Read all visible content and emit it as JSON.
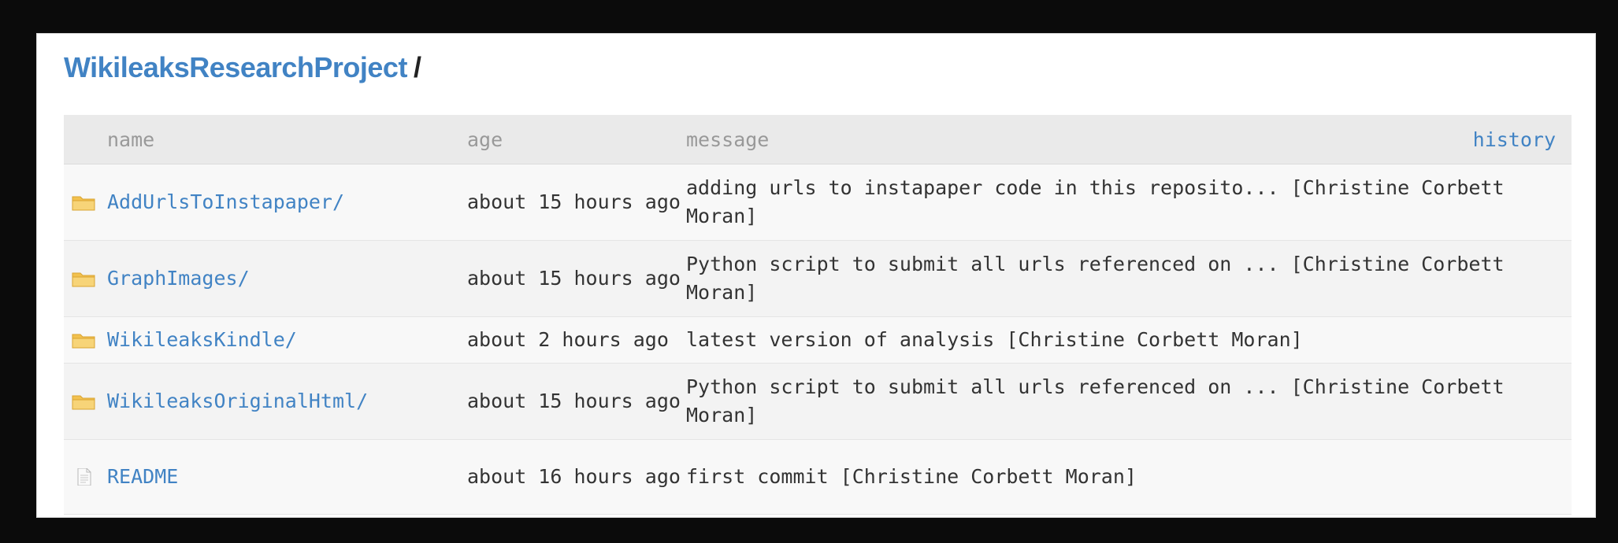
{
  "breadcrumb": {
    "repo": "WikileaksResearchProject",
    "separator": "/"
  },
  "table": {
    "headers": {
      "name": "name",
      "age": "age",
      "message": "message",
      "history": "history"
    },
    "rows": [
      {
        "icon": "folder-icon",
        "name": "AddUrlsToInstapaper/",
        "age": "about 15 hours ago",
        "message": "adding urls to instapaper code in this reposito... [Christine Corbett Moran]"
      },
      {
        "icon": "folder-icon",
        "name": "GraphImages/",
        "age": "about 15 hours ago",
        "message": "Python script to submit all urls referenced on ... [Christine Corbett Moran]"
      },
      {
        "icon": "folder-icon",
        "name": "WikileaksKindle/",
        "age": "about 2 hours ago",
        "message": "latest version of analysis [Christine Corbett Moran]"
      },
      {
        "icon": "folder-icon",
        "name": "WikileaksOriginalHtml/",
        "age": "about 15 hours ago",
        "message": "Python script to submit all urls referenced on ... [Christine Corbett Moran]"
      },
      {
        "icon": "file-icon",
        "name": "README",
        "age": "about 16 hours ago",
        "message": "first commit [Christine Corbett Moran]"
      }
    ]
  },
  "colors": {
    "link": "#4183c4",
    "header_bg": "#eaeaea",
    "folder": "#f2c14e"
  }
}
